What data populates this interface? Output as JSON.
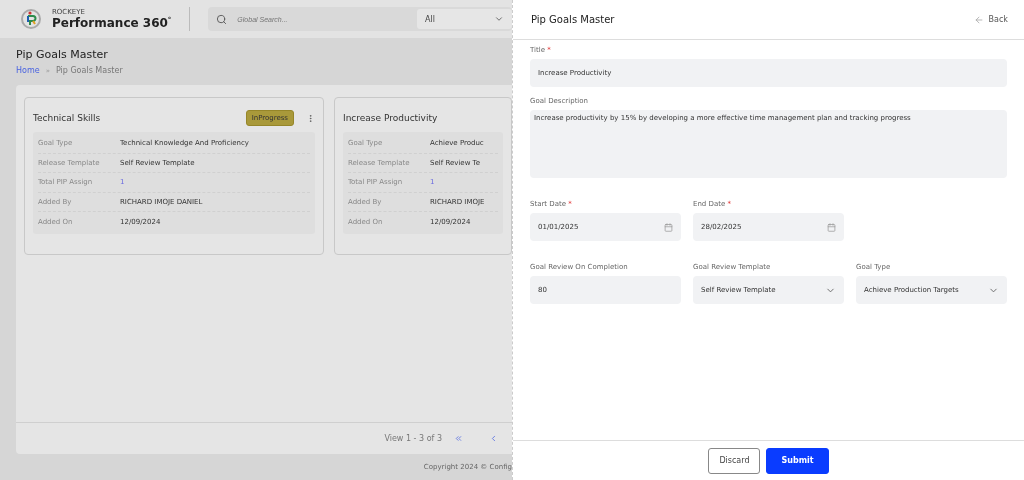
{
  "header": {
    "brand_small": "ROCKEYE",
    "brand_name": "Performance 360",
    "brand_mark": "°",
    "search": {
      "placeholder": "Global Search..."
    },
    "scope": "All"
  },
  "page": {
    "title": "Pip Goals Master",
    "breadcrumb_separator": "»",
    "breadcrumb": [
      {
        "label": "Home",
        "kind": "link"
      },
      {
        "label": "Pip Goals Master",
        "kind": "current"
      }
    ]
  },
  "cards": [
    {
      "title": "Technical Skills",
      "status": "InProgress",
      "fields": [
        {
          "label": "Goal Type",
          "value": "Technical Knowledge And Proficiency",
          "kind": "text"
        },
        {
          "label": "Release Template",
          "value": "Self Review Template",
          "kind": "text"
        },
        {
          "label": "Total PIP Assign",
          "value": "1",
          "kind": "count"
        },
        {
          "label": "Added By",
          "value": "RICHARD IMOJE DANIEL",
          "kind": "text"
        },
        {
          "label": "Added On",
          "value": "12/09/2024",
          "kind": "text"
        }
      ]
    },
    {
      "title": "Increase Productivity",
      "fields": [
        {
          "label": "Goal Type",
          "value": "Achieve Produc",
          "kind": "text"
        },
        {
          "label": "Release Template",
          "value": "Self Review Te",
          "kind": "text"
        },
        {
          "label": "Total PIP Assign",
          "value": "1",
          "kind": "count"
        },
        {
          "label": "Added By",
          "value": "RICHARD IMOJE",
          "kind": "text"
        },
        {
          "label": "Added On",
          "value": "12/09/2024",
          "kind": "text"
        }
      ]
    }
  ],
  "pagination": {
    "summary": "View 1 - 3 of 3"
  },
  "copyright": "Copyright 2024 © Config",
  "drawer": {
    "required_mark": "*",
    "title": "Pip Goals Master",
    "back": "Back",
    "title_field": {
      "label": "Title",
      "required": true,
      "value": "Increase Productivity"
    },
    "description": {
      "label": "Goal Description",
      "value": "Increase productivity by 15% by developing a more effective time management plan and tracking progress"
    },
    "row1": [
      {
        "label": "Start Date",
        "required": true,
        "value": "01/01/2025",
        "kind": "date"
      },
      {
        "label": "End Date",
        "required": true,
        "value": "28/02/2025",
        "kind": "date"
      }
    ],
    "row2": [
      {
        "label": "Goal Review On Completion",
        "required": false,
        "value": "80",
        "kind": "text"
      },
      {
        "label": "Goal Review Template",
        "required": false,
        "value": "Self Review Template",
        "kind": "select"
      },
      {
        "label": "Goal Type",
        "required": false,
        "value": "Achieve Production Targets",
        "kind": "select"
      }
    ],
    "buttons": [
      {
        "label": "Discard",
        "kind": "secondary"
      },
      {
        "label": "Submit",
        "kind": "primary"
      }
    ]
  }
}
